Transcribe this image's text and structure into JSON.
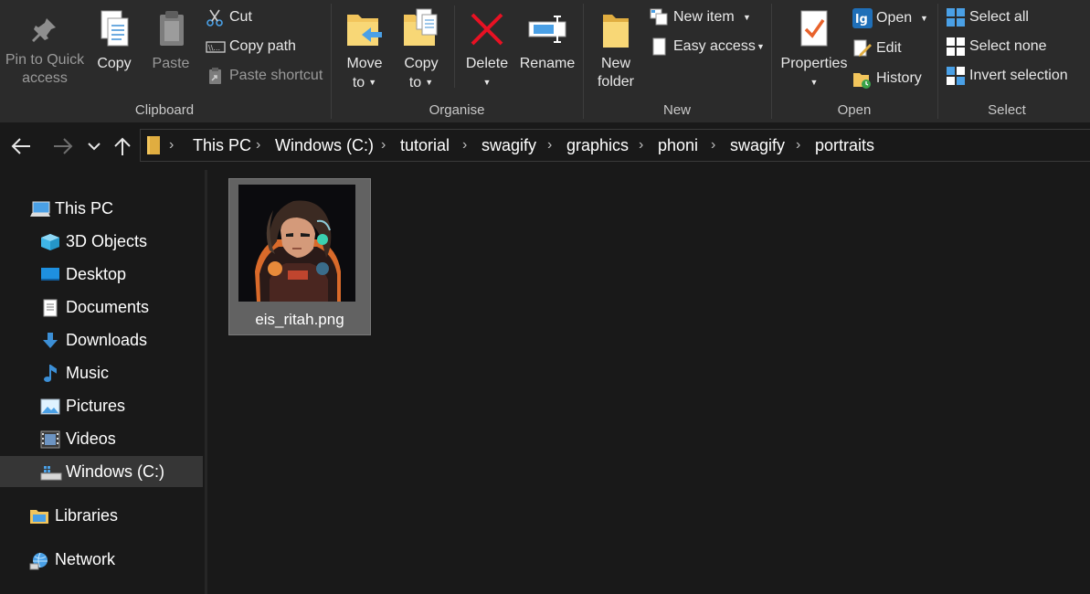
{
  "ribbon": {
    "clipboard": {
      "label": "Clipboard",
      "pin_line1": "Pin to Quick",
      "pin_line2": "access",
      "copy": "Copy",
      "paste": "Paste",
      "cut": "Cut",
      "copy_path": "Copy path",
      "paste_shortcut": "Paste shortcut"
    },
    "organise": {
      "label": "Organise",
      "move_line1": "Move",
      "move_line2": "to",
      "copy_line1": "Copy",
      "copy_line2": "to",
      "delete": "Delete",
      "rename": "Rename"
    },
    "new": {
      "label": "New",
      "new_folder_line1": "New",
      "new_folder_line2": "folder",
      "new_item": "New item",
      "easy_access": "Easy access"
    },
    "open": {
      "label": "Open",
      "properties": "Properties",
      "open": "Open",
      "edit": "Edit",
      "history": "History"
    },
    "select": {
      "label": "Select",
      "select_all": "Select all",
      "select_none": "Select none",
      "invert_selection": "Invert selection"
    }
  },
  "nav": {
    "back_icon": "arrow-left-icon",
    "forward_icon": "arrow-right-icon",
    "recent_icon": "chevron-down-icon",
    "up_icon": "arrow-up-icon"
  },
  "address": {
    "crumbs": [
      "This PC",
      "Windows (C:)",
      "tutorial",
      "swagify",
      "graphics",
      "phoni",
      "swagify",
      "portraits"
    ]
  },
  "sidebar": {
    "items": [
      {
        "label": "This PC",
        "icon": "computer-icon"
      },
      {
        "label": "3D Objects",
        "icon": "cube-icon"
      },
      {
        "label": "Desktop",
        "icon": "desktop-icon"
      },
      {
        "label": "Documents",
        "icon": "document-icon"
      },
      {
        "label": "Downloads",
        "icon": "download-icon"
      },
      {
        "label": "Music",
        "icon": "music-icon"
      },
      {
        "label": "Pictures",
        "icon": "picture-icon"
      },
      {
        "label": "Videos",
        "icon": "video-icon"
      },
      {
        "label": "Windows (C:)",
        "icon": "drive-icon"
      },
      {
        "label": "Libraries",
        "icon": "library-icon"
      },
      {
        "label": "Network",
        "icon": "network-icon"
      }
    ]
  },
  "files": [
    {
      "name": "eis_ritah.png",
      "icon": "image-thumbnail"
    }
  ],
  "colors": {
    "ribbon_bg": "#2b2b2b",
    "window_bg": "#191919",
    "selected_bg": "#626262",
    "accent_blue": "#4aa0e6",
    "delete_red": "#e81123",
    "folder_yellow": "#f2c55c"
  }
}
